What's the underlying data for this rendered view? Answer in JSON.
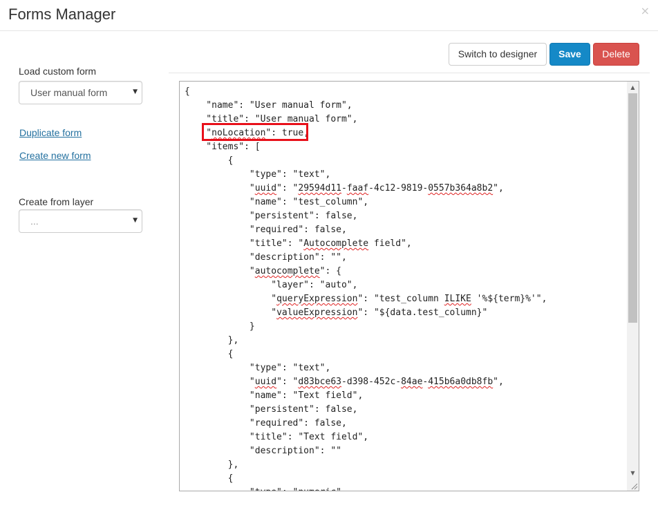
{
  "header": {
    "title": "Forms Manager",
    "close_label": "×"
  },
  "sidebar": {
    "load_label": "Load custom form",
    "load_select_value": "User manual form",
    "duplicate_link": "Duplicate form",
    "create_new_link": "Create new form",
    "create_from_layer_label": "Create from layer",
    "layer_select_value": "..."
  },
  "toolbar": {
    "designer_label": "Switch to designer",
    "save_label": "Save",
    "delete_label": "Delete"
  },
  "editor": {
    "lines": [
      "{",
      "    \"name\": \"User manual form\",",
      "    \"title\": \"User manual form\",",
      "    \"noLocation\": true,",
      "    \"items\": [",
      "        {",
      "            \"type\": \"text\",",
      "            \"uuid\": \"29594d11-faaf-4c12-9819-0557b364a8b2\",",
      "            \"name\": \"test_column\",",
      "            \"persistent\": false,",
      "            \"required\": false,",
      "            \"title\": \"Autocomplete field\",",
      "            \"description\": \"\",",
      "            \"autocomplete\": {",
      "                \"layer\": \"auto\",",
      "                \"queryExpression\": \"test_column ILIKE '%${term}%'\",",
      "                \"valueExpression\": \"${data.test_column}\"",
      "            }",
      "        },",
      "        {",
      "            \"type\": \"text\",",
      "            \"uuid\": \"d83bce63-d398-452c-84ae-415b6a0db8fb\",",
      "            \"name\": \"Text field\",",
      "            \"persistent\": false,",
      "            \"required\": false,",
      "            \"title\": \"Text field\",",
      "            \"description\": \"\"",
      "        },",
      "        {",
      "            \"type\": \"numeric\","
    ],
    "highlight_color": "#e8101a"
  },
  "colors": {
    "save": "#1589c7",
    "delete": "#d9534f",
    "link": "#23709f"
  }
}
